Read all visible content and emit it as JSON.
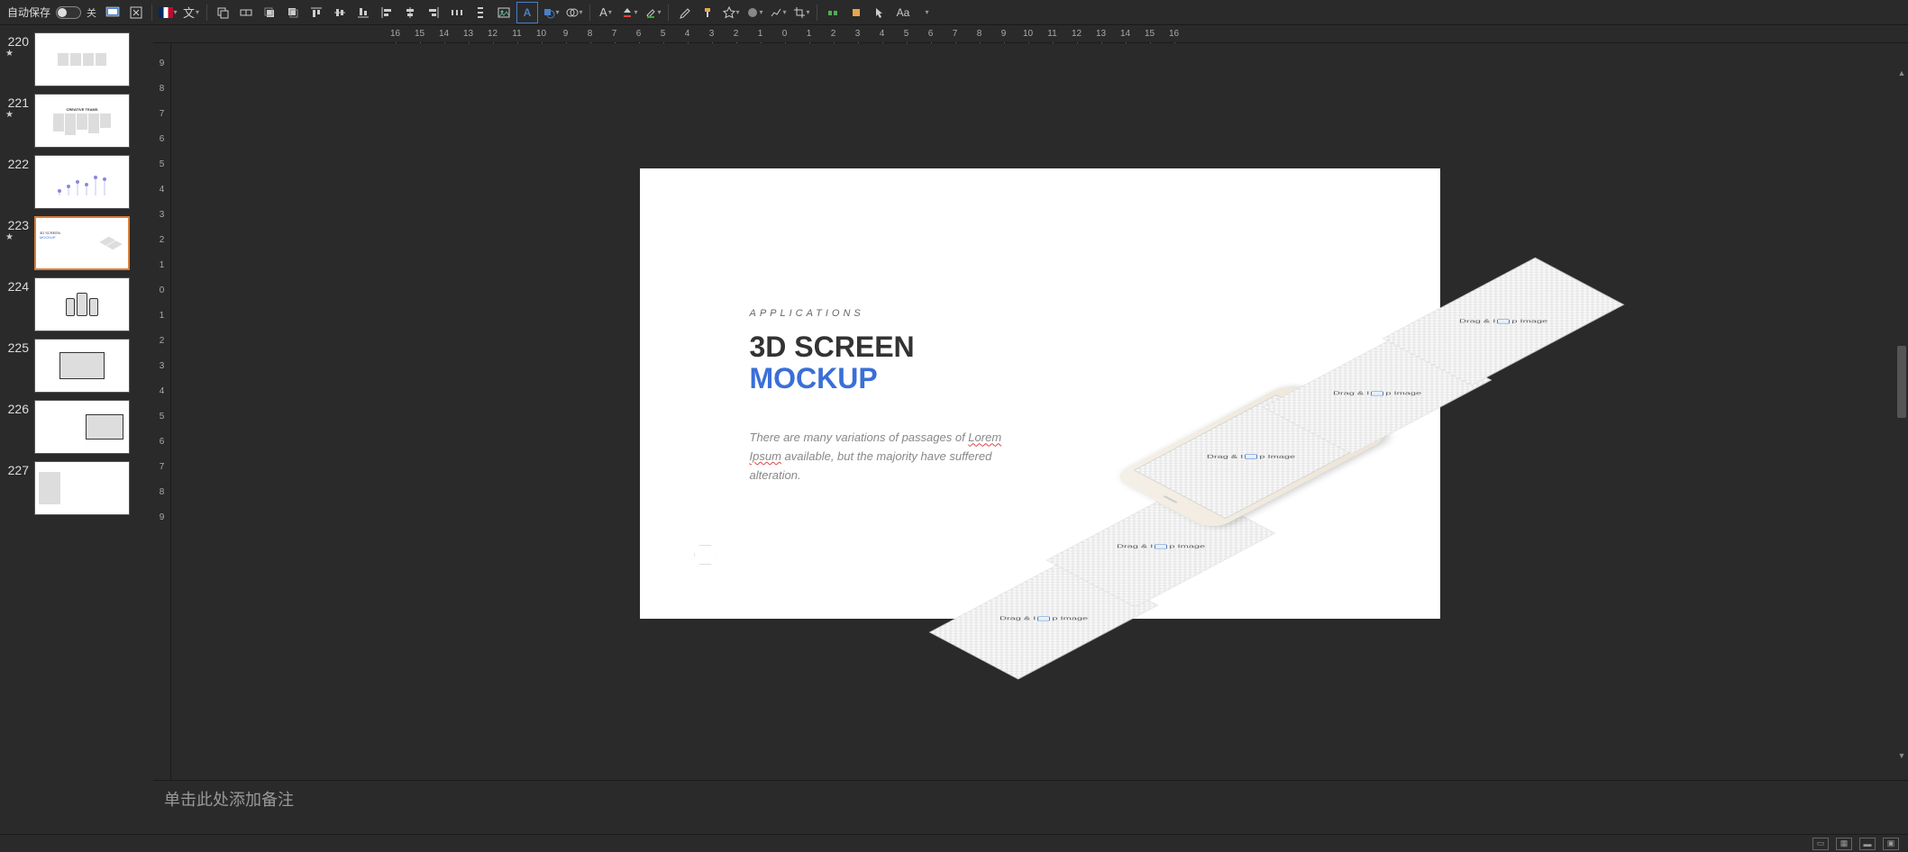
{
  "toolbar": {
    "autosave_label": "自动保存",
    "autosave_state": "关"
  },
  "ruler_h": [
    "16",
    "15",
    "14",
    "13",
    "12",
    "11",
    "10",
    "9",
    "8",
    "7",
    "6",
    "5",
    "4",
    "3",
    "2",
    "1",
    "0",
    "1",
    "2",
    "3",
    "4",
    "5",
    "6",
    "7",
    "8",
    "9",
    "10",
    "11",
    "12",
    "13",
    "14",
    "15",
    "16"
  ],
  "ruler_v": [
    "9",
    "8",
    "7",
    "6",
    "5",
    "4",
    "3",
    "2",
    "1",
    "0",
    "1",
    "2",
    "3",
    "4",
    "5",
    "6",
    "7",
    "8",
    "9"
  ],
  "slides": [
    {
      "num": "220",
      "star": true,
      "desc": "grid boxes"
    },
    {
      "num": "221",
      "star": true,
      "desc": "CREATIVE TEAMS"
    },
    {
      "num": "222",
      "star": false,
      "desc": "dots chart"
    },
    {
      "num": "223",
      "star": true,
      "desc": "3D SCREEN MOCKUP",
      "active": true
    },
    {
      "num": "224",
      "star": false,
      "desc": "phones"
    },
    {
      "num": "225",
      "star": false,
      "desc": "frame"
    },
    {
      "num": "226",
      "star": false,
      "desc": "screen"
    },
    {
      "num": "227",
      "star": false,
      "desc": "text panel"
    }
  ],
  "slide": {
    "overline": "APPLICATIONS",
    "title1": "3D SCREEN",
    "title2": "MOCKUP",
    "body_pre": "There are many variations of passages of ",
    "body_link": "Lorem Ipsum",
    "body_post": " available, but the majority have suffered alteration.",
    "tile_label": "Drag & Drop Image"
  },
  "notes_placeholder": "单击此处添加备注",
  "thumb_titles": {
    "221": "CREATIVE TEAMS"
  }
}
